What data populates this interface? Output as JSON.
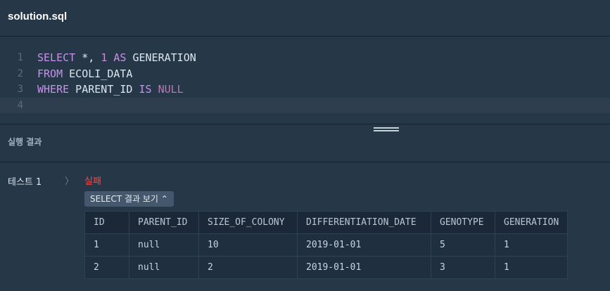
{
  "file": {
    "title": "solution.sql"
  },
  "editor": {
    "line_numbers": [
      "1",
      "2",
      "3",
      "4"
    ],
    "line1": {
      "kw_select": "SELECT",
      "star": " *, ",
      "num": "1",
      "sp1": " ",
      "kw_as": "AS",
      "alias": " GENERATION"
    },
    "line2": {
      "kw_from": "FROM",
      "table": " ECOLI_DATA"
    },
    "line3": {
      "kw_where": "WHERE",
      "col": " PARENT_ID ",
      "kw_is": "IS",
      "sp": " ",
      "null": "NULL"
    }
  },
  "results": {
    "label": "실행 결과",
    "test_label": "테스트 1",
    "chevron": "〉",
    "status": "실패",
    "toggle_label": "SELECT 결과 보기 ⌃",
    "columns": [
      "ID",
      "PARENT_ID",
      "SIZE_OF_COLONY",
      "DIFFERENTIATION_DATE",
      "GENOTYPE",
      "GENERATION"
    ],
    "rows": [
      [
        "1",
        "null",
        "10",
        "2019-01-01",
        "5",
        "1"
      ],
      [
        "2",
        "null",
        "2",
        "2019-01-01",
        "3",
        "1"
      ]
    ]
  },
  "colors": {
    "background": "#263747",
    "fail": "#ee4d4d",
    "keyword": "#c792ea"
  }
}
